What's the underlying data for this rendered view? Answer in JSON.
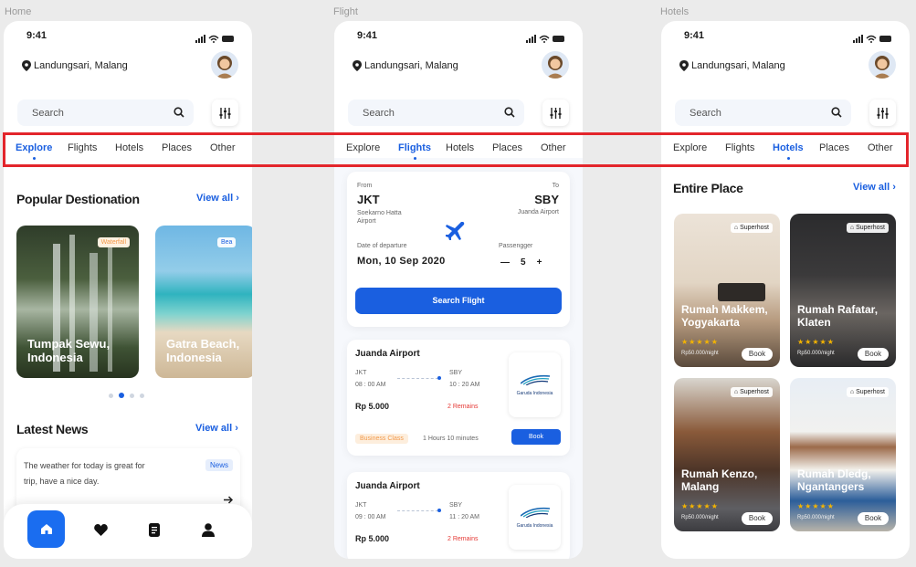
{
  "frames": {
    "home": "Home",
    "flight": "Flight",
    "hotels": "Hotels"
  },
  "status": {
    "time": "9:41"
  },
  "location": "Landungsari, Malang",
  "search": {
    "placeholder": "Search"
  },
  "tabs": [
    "Explore",
    "Flights",
    "Hotels",
    "Places",
    "Other"
  ],
  "colors": {
    "accent": "#1a5fe0",
    "highlight": "#e3252b",
    "remains": "#e53935",
    "badge": "#f2994a"
  },
  "home": {
    "popular_title": "Popular Destionation",
    "view_all": "View all",
    "destinations": [
      {
        "name": "Tumpak Sewu, Indonesia",
        "badge": "Waterfall"
      },
      {
        "name": "Gatra Beach, Indonesia",
        "badge": "Bea"
      }
    ],
    "carousel_pages": 4,
    "carousel_active": 2,
    "news_title": "Latest News",
    "news_view_all": "View all",
    "news_item": {
      "text": "The weather for today is great for trip, have a nice day.",
      "badge": "News"
    },
    "nav_icons": [
      "home-icon",
      "heart-icon",
      "document-icon",
      "user-icon"
    ]
  },
  "flight": {
    "from_label": "From",
    "to_label": "To",
    "from_code": "JKT",
    "from_airport": "Soekarno Hatta Airport",
    "to_code": "SBY",
    "to_airport": "Juanda Airport",
    "date_label": "Date of departure",
    "date_value": "Mon, 10 Sep 2020",
    "passenger_label": "Passengger",
    "passenger_count": "5",
    "minus": "—",
    "plus": "+",
    "search_button": "Search Flight",
    "results": [
      {
        "airport": "Juanda Airport",
        "from": "JKT",
        "dep": "08 : 00 AM",
        "to": "SBY",
        "arr": "10 : 20 AM",
        "price": "Rp 5.000",
        "remains": "2 Remains",
        "class": "Business Class",
        "duration": "1 Hours 10 minutes",
        "book": "Book",
        "airline": "Garuda Indonesia"
      },
      {
        "airport": "Juanda Airport",
        "from": "JKT",
        "dep": "09 : 00 AM",
        "to": "SBY",
        "arr": "11 : 20 AM",
        "price": "Rp 5.000",
        "remains": "2 Remains",
        "airline": "Garuda Indonesia"
      }
    ]
  },
  "hotels": {
    "title": "Entire Place",
    "view_all": "View all",
    "items": [
      {
        "name": "Rumah Makkem, Yogyakarta",
        "badge": "Superhost",
        "price": "Rp50.000/night",
        "book": "Book",
        "rating": 5
      },
      {
        "name": "Rumah Rafatar, Klaten",
        "badge": "Superhost",
        "price": "Rp50.000/night",
        "book": "Book",
        "rating": 5
      },
      {
        "name": "Rumah Kenzo, Malang",
        "badge": "Superhost",
        "price": "Rp50.000/night",
        "book": "Book",
        "rating": 5
      },
      {
        "name": "Rumah Dledg, Ngantangers",
        "badge": "Superhost",
        "price": "Rp50.000/night",
        "book": "Book",
        "rating": 5
      }
    ]
  }
}
